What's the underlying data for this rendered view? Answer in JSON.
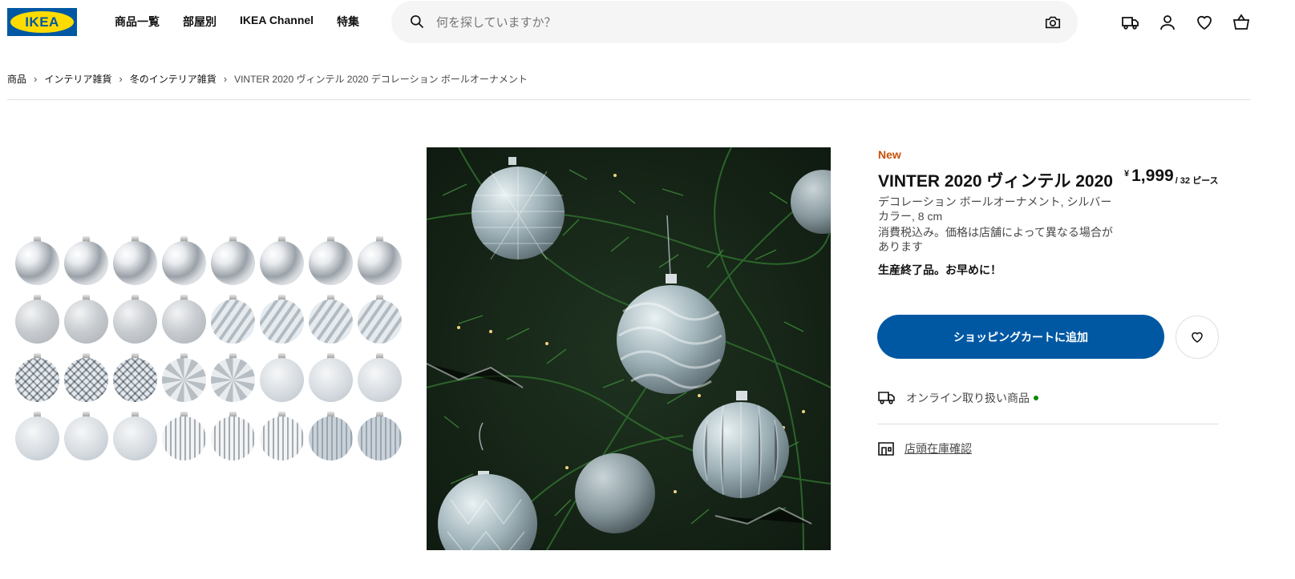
{
  "header": {
    "logo_text": "IKEA",
    "nav": [
      "商品一覧",
      "部屋別",
      "IKEA Channel",
      "特集"
    ],
    "search_placeholder": "何を探していますか？",
    "icons": [
      "delivery-truck-icon",
      "user-icon",
      "heart-icon",
      "shopping-bag-icon"
    ]
  },
  "breadcrumb": {
    "items": [
      "商品",
      "インテリア雑貨",
      "冬のインテリア雑貨"
    ],
    "current": "VINTER 2020 ヴィンテル 2020 デコレーション ボールオーナメント"
  },
  "gallery": {
    "ornament_styles": [
      "shiny",
      "shiny",
      "shiny",
      "shiny",
      "shiny",
      "shiny",
      "shiny",
      "shiny",
      "matte",
      "matte",
      "matte",
      "matte",
      "swirl",
      "swirl",
      "swirl",
      "swirl",
      "diamond",
      "diamond",
      "diamond",
      "facet",
      "facet",
      "glitter",
      "glitter",
      "glitter",
      "glitter",
      "glitter",
      "glitter",
      "ribbed",
      "ribbed",
      "ribbed",
      "ribbed-blue",
      "ribbed-blue"
    ]
  },
  "product": {
    "tag": "New",
    "title": "VINTER 2020 ヴィンテル 2020",
    "price_currency": "¥",
    "price_amount": "1,999",
    "price_unit": "/ 32 ピース",
    "description": "デコレーション ボールオーナメント, シルバーカラー, 8 cm",
    "price_note": "消費税込み。価格は店舗によって異なる場合があります",
    "discontinued": "生産終了品。お早めに！",
    "cart_button": "ショッピングカートに追加",
    "online_label": "オンライン取り扱い商品",
    "store_label": "店頭在庫確認"
  },
  "colors": {
    "brand_blue": "#0058a3",
    "brand_yellow": "#ffdb00",
    "new_tag": "#ca5008",
    "available_green": "#0a8a00"
  }
}
